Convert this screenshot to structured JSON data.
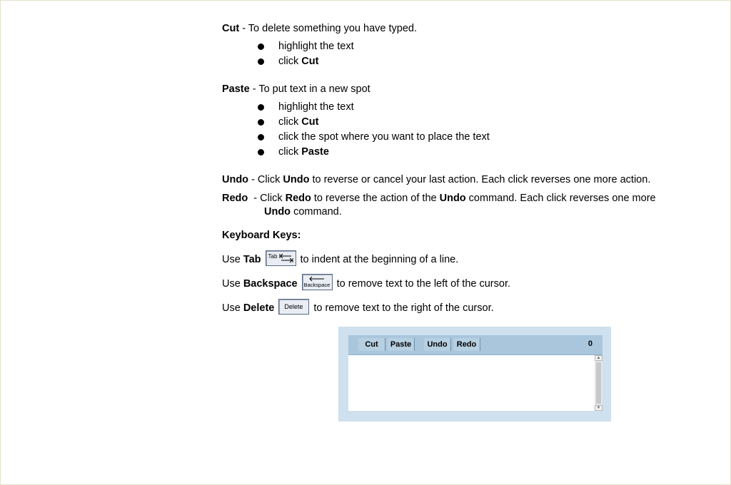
{
  "cut": {
    "heading": "Cut",
    "description": " - To delete something you have typed.",
    "steps": [
      {
        "text": "highlight the text",
        "bold": ""
      },
      {
        "text": "click ",
        "bold": "Cut"
      }
    ]
  },
  "paste": {
    "heading": "Paste",
    "description": " - To put text in a new spot",
    "steps": [
      {
        "text": "highlight the text",
        "bold": ""
      },
      {
        "text": "click ",
        "bold": "Cut"
      },
      {
        "text": "click the spot where you want to place the text",
        "bold": ""
      },
      {
        "text": "click ",
        "bold": "Paste"
      }
    ]
  },
  "undo": {
    "heading": "Undo",
    "t1": " - Click ",
    "b1": "Undo",
    "t2": " to reverse or cancel your last action. Each click reverses one more action."
  },
  "redo": {
    "heading": "Redo",
    "t1": "  - Click ",
    "b1": "Redo",
    "t2": " to reverse the action of the ",
    "b2": "Undo",
    "t3": " command. Each click reverses one more",
    "b3": "Undo",
    "t4": " command."
  },
  "keyboard": {
    "heading": "Keyboard Keys:",
    "tab": {
      "use": "Use ",
      "key": "Tab",
      "icon_label": "Tab",
      "rest": "to indent at the beginning of a line."
    },
    "backspace": {
      "use": "Use ",
      "key": "Backspace",
      "icon_label": "Backspace",
      "rest": "to remove text to the left of the cursor."
    },
    "delete": {
      "use": "Use ",
      "key": "Delete",
      "icon_label": "Delete",
      "rest": "to remove text to the right of the cursor."
    }
  },
  "editor": {
    "buttons": {
      "cut": "Cut",
      "paste": "Paste",
      "undo": "Undo",
      "redo": "Redo"
    },
    "count": "0",
    "text_value": ""
  }
}
